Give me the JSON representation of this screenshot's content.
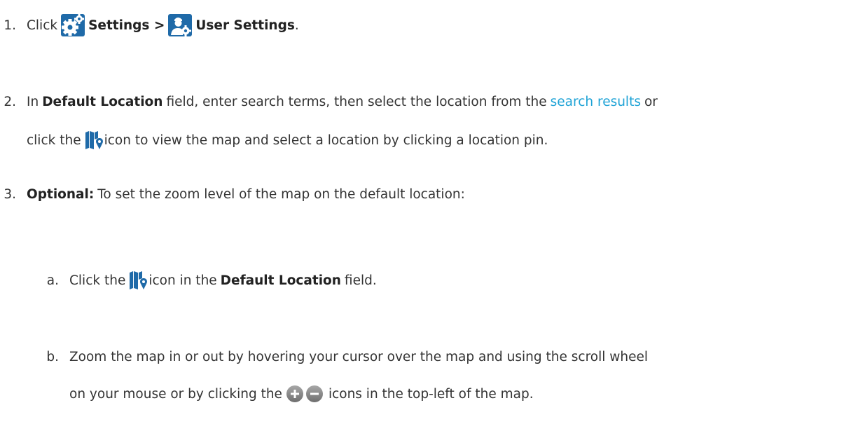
{
  "steps": [
    {
      "number": "1.",
      "text_click": "Click",
      "settings_label": "Settings >",
      "user_settings_label": "User Settings",
      "period": "."
    },
    {
      "number": "2.",
      "text_in": "In",
      "field_name": "Default Location",
      "text_mid": "field, enter search terms, then select the location from the",
      "link_text": "search results",
      "text_or": "or",
      "text_click_the": "click the",
      "text_after_icon": "icon to view the map and select a location by clicking a location pin."
    },
    {
      "number": "3.",
      "optional_label": "Optional:",
      "text": "To set the zoom level of the map on the default location:"
    }
  ],
  "substeps": [
    {
      "letter": "a.",
      "text_click_the": "Click the",
      "text_icon_in": "icon in the",
      "field_name": "Default Location",
      "text_end": "field."
    },
    {
      "letter": "b.",
      "line1": "Zoom the map in or out by hovering your cursor over the map and using the scroll wheel",
      "line2_start": "on your mouse or by clicking the",
      "line2_end": "icons in the top-left of the map."
    }
  ],
  "icons": {
    "settings": "gear-icon",
    "user_settings": "user-gear-icon",
    "map": "map-pin-icon",
    "zoom": "zoom-in-out-icon"
  },
  "colors": {
    "link": "#1fa3d6",
    "icon_blue": "#1f6aa8"
  }
}
